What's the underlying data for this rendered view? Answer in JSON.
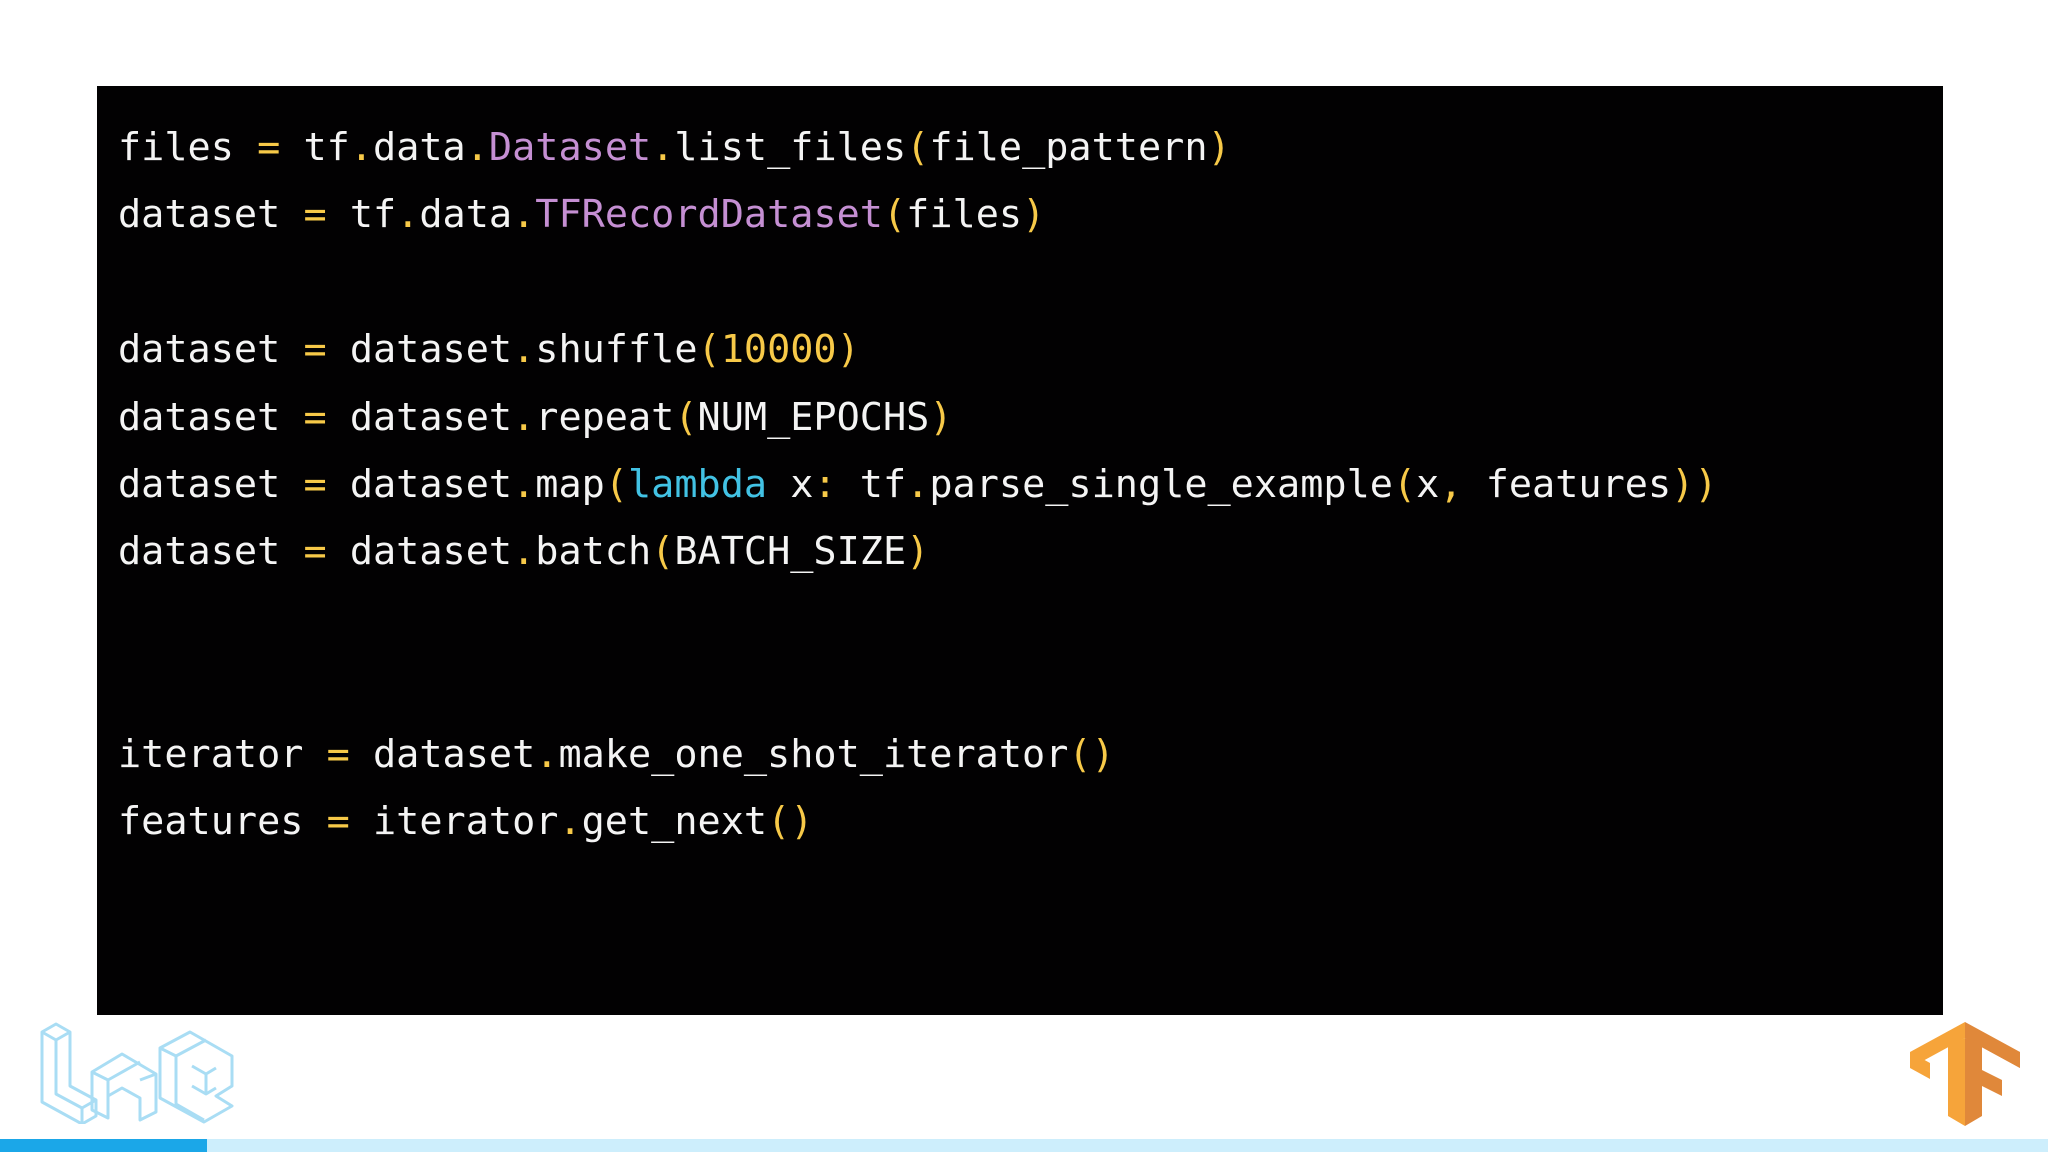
{
  "code_lines": [
    [
      {
        "t": "files",
        "k": "id"
      },
      {
        "t": " ",
        "k": "id"
      },
      {
        "t": "=",
        "k": "op"
      },
      {
        "t": " tf",
        "k": "id"
      },
      {
        "t": ".",
        "k": "op"
      },
      {
        "t": "data",
        "k": "id"
      },
      {
        "t": ".",
        "k": "op"
      },
      {
        "t": "Dataset",
        "k": "cls"
      },
      {
        "t": ".",
        "k": "op"
      },
      {
        "t": "list_files",
        "k": "id"
      },
      {
        "t": "(",
        "k": "op"
      },
      {
        "t": "file_pattern",
        "k": "id"
      },
      {
        "t": ")",
        "k": "op"
      }
    ],
    [
      {
        "t": "dataset",
        "k": "id"
      },
      {
        "t": " ",
        "k": "id"
      },
      {
        "t": "=",
        "k": "op"
      },
      {
        "t": " tf",
        "k": "id"
      },
      {
        "t": ".",
        "k": "op"
      },
      {
        "t": "data",
        "k": "id"
      },
      {
        "t": ".",
        "k": "op"
      },
      {
        "t": "TFRecordDataset",
        "k": "cls"
      },
      {
        "t": "(",
        "k": "op"
      },
      {
        "t": "files",
        "k": "id"
      },
      {
        "t": ")",
        "k": "op"
      }
    ],
    [],
    [
      {
        "t": "dataset",
        "k": "id"
      },
      {
        "t": " ",
        "k": "id"
      },
      {
        "t": "=",
        "k": "op"
      },
      {
        "t": " dataset",
        "k": "id"
      },
      {
        "t": ".",
        "k": "op"
      },
      {
        "t": "shuffle",
        "k": "id"
      },
      {
        "t": "(",
        "k": "op"
      },
      {
        "t": "10000",
        "k": "num"
      },
      {
        "t": ")",
        "k": "op"
      }
    ],
    [
      {
        "t": "dataset",
        "k": "id"
      },
      {
        "t": " ",
        "k": "id"
      },
      {
        "t": "=",
        "k": "op"
      },
      {
        "t": " dataset",
        "k": "id"
      },
      {
        "t": ".",
        "k": "op"
      },
      {
        "t": "repeat",
        "k": "id"
      },
      {
        "t": "(",
        "k": "op"
      },
      {
        "t": "NUM_EPOCHS",
        "k": "id"
      },
      {
        "t": ")",
        "k": "op"
      }
    ],
    [
      {
        "t": "dataset",
        "k": "id"
      },
      {
        "t": " ",
        "k": "id"
      },
      {
        "t": "=",
        "k": "op"
      },
      {
        "t": " dataset",
        "k": "id"
      },
      {
        "t": ".",
        "k": "op"
      },
      {
        "t": "map",
        "k": "id"
      },
      {
        "t": "(",
        "k": "op"
      },
      {
        "t": "lambda",
        "k": "kw"
      },
      {
        "t": " x",
        "k": "id"
      },
      {
        "t": ":",
        "k": "op"
      },
      {
        "t": " tf",
        "k": "id"
      },
      {
        "t": ".",
        "k": "op"
      },
      {
        "t": "parse_single_example",
        "k": "id"
      },
      {
        "t": "(",
        "k": "op"
      },
      {
        "t": "x",
        "k": "id"
      },
      {
        "t": ",",
        "k": "op"
      },
      {
        "t": " features",
        "k": "id"
      },
      {
        "t": "))",
        "k": "op"
      }
    ],
    [
      {
        "t": "dataset",
        "k": "id"
      },
      {
        "t": " ",
        "k": "id"
      },
      {
        "t": "=",
        "k": "op"
      },
      {
        "t": " dataset",
        "k": "id"
      },
      {
        "t": ".",
        "k": "op"
      },
      {
        "t": "batch",
        "k": "id"
      },
      {
        "t": "(",
        "k": "op"
      },
      {
        "t": "BATCH_SIZE",
        "k": "id"
      },
      {
        "t": ")",
        "k": "op"
      }
    ],
    [],
    [],
    [
      {
        "t": "iterator",
        "k": "id"
      },
      {
        "t": " ",
        "k": "id"
      },
      {
        "t": "=",
        "k": "op"
      },
      {
        "t": " dataset",
        "k": "id"
      },
      {
        "t": ".",
        "k": "op"
      },
      {
        "t": "make_one_shot_iterator",
        "k": "id"
      },
      {
        "t": "()",
        "k": "op"
      }
    ],
    [
      {
        "t": "features",
        "k": "id"
      },
      {
        "t": " ",
        "k": "id"
      },
      {
        "t": "=",
        "k": "op"
      },
      {
        "t": " iterator",
        "k": "id"
      },
      {
        "t": ".",
        "k": "op"
      },
      {
        "t": "get_next",
        "k": "id"
      },
      {
        "t": "()",
        "k": "op"
      }
    ]
  ],
  "logos": {
    "left": "lab-logo",
    "right": "tensorflow-logo"
  },
  "progress": {
    "fraction": 0.101
  },
  "colors": {
    "code_background": "#020102",
    "identifier": "#f4f4f4",
    "operator": "#f7c948",
    "class_name": "#c58fd3",
    "number": "#f7c948",
    "keyword": "#42c2e4",
    "progress_track": "#cdeefc",
    "progress_fill": "#1ba7e8"
  }
}
